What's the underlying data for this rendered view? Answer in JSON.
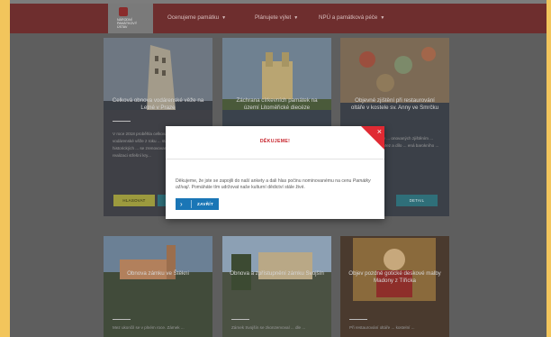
{
  "nav": {
    "logo_text": "NÁRODNÍ\nPAMÁTKOVÝ\nÚSTAV",
    "items": [
      {
        "label": "Ocenujeme památku"
      },
      {
        "label": "Plánujete výlet"
      },
      {
        "label": "NPÚ a památková péče"
      }
    ]
  },
  "cards": [
    {
      "title": "Celková obnova vodárenské věže na Letné v Praze",
      "desc": "V roce 2018 proběhla celková obnova vodárenské věže z roku ... stavebních prvků a historických ... se zrenovovaným vnitřním ... i realizaci střešní kry...",
      "btn_vote": "HLASOVAT",
      "btn_detail": "DETAIL"
    },
    {
      "title": "Záchrana církevních památek na území Litoměřické diecéze",
      "desc": "",
      "btn_vote": "",
      "btn_detail": ""
    },
    {
      "title": "Objevné zjištění při restaurování oltáře v kostele sv. Anny ve Smrčku",
      "desc": "... ní oltáře sv. Anny ... onovaných zjištěním ... olitě figurálních ... Mez a dílo ... ená barokního ...",
      "btn_vote": "",
      "btn_detail": "DETAIL"
    },
    {
      "title": "Obnova zámku ve Štěkni",
      "desc": "Mez ukončil se v plném roce. Zámek ...",
      "btn_vote": "",
      "btn_detail": ""
    },
    {
      "title": "Obnova a zpřístupnění zámku Svojšín",
      "desc": "Zámek Svojšín se zkonzervoval ... dle ...",
      "btn_vote": "",
      "btn_detail": ""
    },
    {
      "title": "Objev pozdně gotické deskové malby Madony z Tířicka",
      "desc": "Při restaurování oltáře ... kostelní ...",
      "btn_vote": "",
      "btn_detail": ""
    }
  ],
  "modal": {
    "title": "DĚKUJEME!",
    "close": "×",
    "body_1": "Děkujeme, že jste se zapojili do naší ankety a dali hlas počinu nominovanému na cenu ",
    "body_italic": "Památky ožívají",
    "body_2": ". Pomáháte tím udržovat naše kulturní dědictví stále živé.",
    "button_label": "ZAVŘÍT",
    "button_chevron": "›"
  },
  "colors": {
    "nav": "#6e2e2e",
    "accent": "#e02a33",
    "button": "#1a76b6",
    "vote": "#9c9a3e",
    "detail": "#2f6f79"
  }
}
